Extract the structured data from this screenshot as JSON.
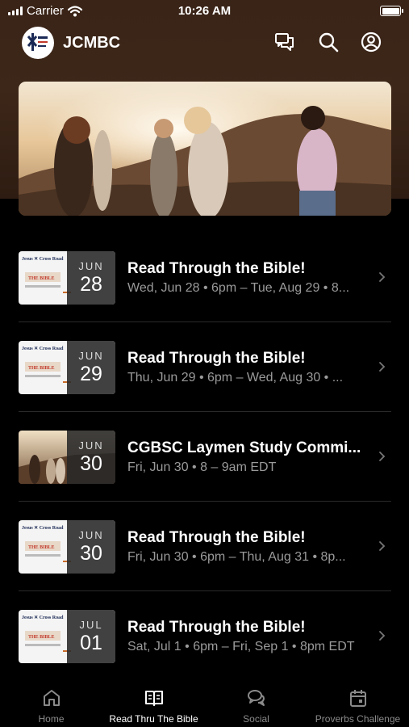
{
  "status_bar": {
    "carrier": "Carrier",
    "time": "10:26 AM"
  },
  "header": {
    "title": "JCMBC",
    "icons": [
      "chat-icon",
      "search-icon",
      "account-icon"
    ]
  },
  "events": [
    {
      "month": "JUN",
      "day": "28",
      "title": "Read Through the Bible!",
      "subtitle": "Wed, Jun 28 • 6pm – Tue, Aug 29 • 8...",
      "thumb": "bible-flyer"
    },
    {
      "month": "JUN",
      "day": "29",
      "title": "Read Through the Bible!",
      "subtitle": "Thu, Jun 29 • 6pm – Wed, Aug 30 • ...",
      "thumb": "bible-flyer"
    },
    {
      "month": "JUN",
      "day": "30",
      "title": "CGBSC Laymen Study Commi...",
      "subtitle": "Fri, Jun 30 • 8 – 9am EDT",
      "thumb": "sunset-photo"
    },
    {
      "month": "JUN",
      "day": "30",
      "title": "Read Through the Bible!",
      "subtitle": "Fri, Jun 30 • 6pm – Thu, Aug 31 • 8p...",
      "thumb": "bible-flyer"
    },
    {
      "month": "JUL",
      "day": "01",
      "title": "Read Through the Bible!",
      "subtitle": "Sat, Jul 1 • 6pm – Fri, Sep 1 • 8pm EDT",
      "thumb": "bible-flyer"
    }
  ],
  "tabs": [
    {
      "label": "Home",
      "icon": "home-icon",
      "active": false
    },
    {
      "label": "Read Thru The Bible",
      "icon": "book-icon",
      "active": true
    },
    {
      "label": "Social",
      "icon": "chat-bubbles-icon",
      "active": false
    },
    {
      "label": "Proverbs Challenge",
      "icon": "calendar-icon",
      "active": false
    }
  ],
  "colors": {
    "header_background": "#3a2417",
    "background": "#000000",
    "secondary_text": "#9a9a9a",
    "inactive_tab": "#8a8a8a"
  }
}
